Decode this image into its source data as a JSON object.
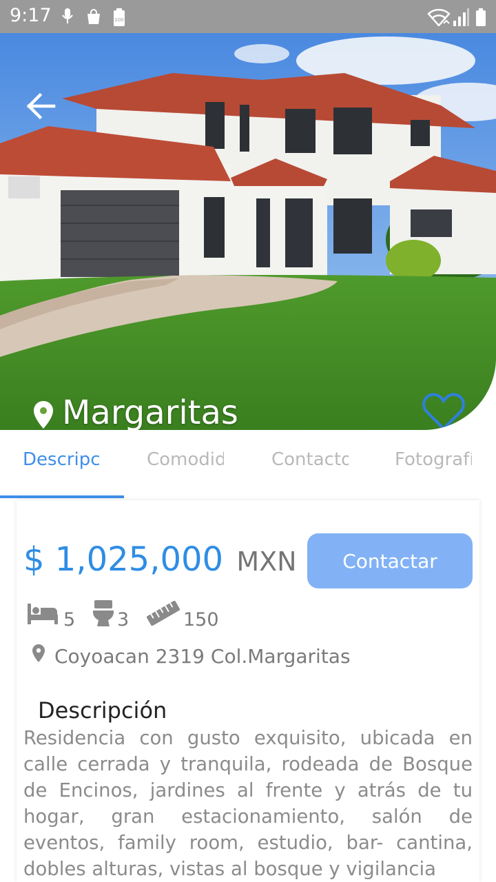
{
  "status_bar": {
    "time": "9:17",
    "battery_label": "100",
    "icons": [
      "mic-icon",
      "shopping-bag-icon",
      "battery-saver-icon",
      "wifi-icon",
      "signal-icon",
      "battery-icon"
    ]
  },
  "property": {
    "title": "Margaritas",
    "price": "$ 1,025,000",
    "currency": "MXN",
    "address": "Coyoacan 2319 Col.Margaritas"
  },
  "tabs": [
    {
      "label": "Descripción",
      "active": true
    },
    {
      "label": "Comodidades",
      "active": false
    },
    {
      "label": "Contacto",
      "active": false
    },
    {
      "label": "Fotografías",
      "active": false
    }
  ],
  "actions": {
    "contact_label": "Contactar"
  },
  "features": {
    "bedrooms": "5",
    "bathrooms": "3",
    "area": "150"
  },
  "description": {
    "heading": "Descripción",
    "text": "Residencia con gusto exquisito, ubicada en calle cerrada y tranquila, rodeada de Bosque de Encinos, jardines al frente y atrás de tu hogar, gran estacionamiento, salón de eventos, family room, estudio, bar- cantina, dobles alturas, vistas al bosque y vigilancia"
  },
  "colors": {
    "accent": "#3f8ee8",
    "button": "#82b2f5",
    "status_bar": "#9a9a9a",
    "price": "#2f8de4"
  }
}
